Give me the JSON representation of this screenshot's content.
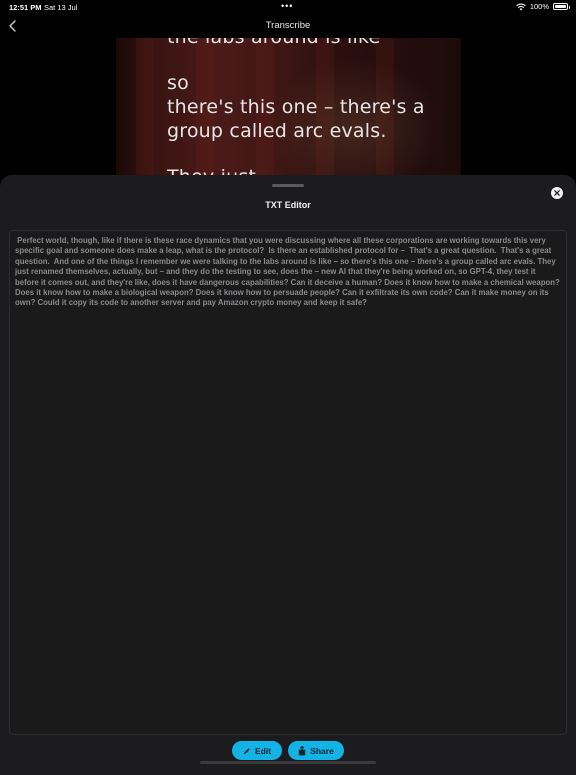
{
  "status_bar": {
    "time": "12:51 PM",
    "date": "Sat 13 Jul",
    "center_dots": "•••",
    "battery": "100%"
  },
  "nav": {
    "title": "Transcribe",
    "back_icon": "chevron-left-icon"
  },
  "video": {
    "captions": [
      "the labs around is like",
      "so",
      "there's this one – there's a",
      "group called arc evals.",
      "They just"
    ]
  },
  "editor": {
    "title": "TXT Editor",
    "close_icon": "close-icon",
    "text": " Perfect world, though, like if there is these race dynamics that you were discussing where all these corporations are working towards this very specific goal and someone does make a leap, what is the protocol?  Is there an established protocol for –  That's a great question.  That's a great question.  And one of the things I remember we were talking to the labs around is like – so there's this one – there's a group called arc evals. They just renamed themselves, actually, but – and they do the testing to see, does the – new AI that they're being worked on, so GPT-4, they test it before it comes out, and they're like, does it have dangerous capabilities? Can it deceive a human? Does it know how to make a chemical weapon? Does it know how to make a biological weapon? Does it know how to persuade people? Can it exfiltrate its own code? Can it make money on its own? Could it copy its code to another server and pay Amazon crypto money and keep it safe?"
  },
  "actions": {
    "edit_label": "Edit",
    "edit_icon": "pencil-icon",
    "share_label": "Share",
    "share_icon": "share-icon"
  },
  "colors": {
    "accent": "#13b3e6",
    "sheet_background": "#1c1c1e",
    "editor_text": "#8a8a8e"
  }
}
